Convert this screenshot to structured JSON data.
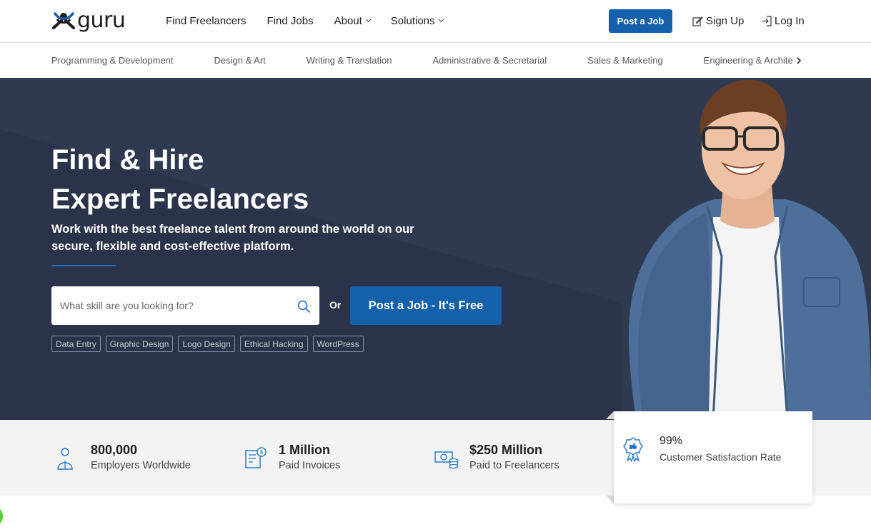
{
  "header": {
    "logo_text": "guru",
    "nav": [
      {
        "label": "Find Freelancers"
      },
      {
        "label": "Find Jobs"
      },
      {
        "label": "About"
      },
      {
        "label": "Solutions"
      }
    ],
    "post_job_label": "Post a Job",
    "sign_up_label": "Sign Up",
    "log_in_label": "Log In"
  },
  "categories": [
    "Programming & Development",
    "Design & Art",
    "Writing & Translation",
    "Administrative & Secretarial",
    "Sales & Marketing",
    "Engineering & Architecture"
  ],
  "hero": {
    "title_line1": "Find & Hire",
    "title_line2": "Expert Freelancers",
    "subtitle": "Work with the best freelance talent from around the world on our secure, flexible and cost-effective platform.",
    "search_placeholder": "What skill are you looking for?",
    "or_text": "Or",
    "cta_label": "Post a Job - It's Free",
    "tags": [
      "Data Entry",
      "Graphic Design",
      "Logo Design",
      "Ethical Hacking",
      "WordPress"
    ]
  },
  "stats": [
    {
      "number": "800,000",
      "label": "Employers Worldwide",
      "icon": "employer-icon"
    },
    {
      "number": "1 Million",
      "label": "Paid Invoices",
      "icon": "invoice-icon"
    },
    {
      "number": "$250 Million",
      "label": "Paid to Freelancers",
      "icon": "money-icon"
    },
    {
      "number": "99%",
      "label": "Customer Satisfaction Rate",
      "icon": "award-badge-icon"
    }
  ],
  "colors": {
    "brand_blue": "#1560aa",
    "hero_bg": "#2f3a51",
    "stats_bg": "#f3f3f3"
  }
}
